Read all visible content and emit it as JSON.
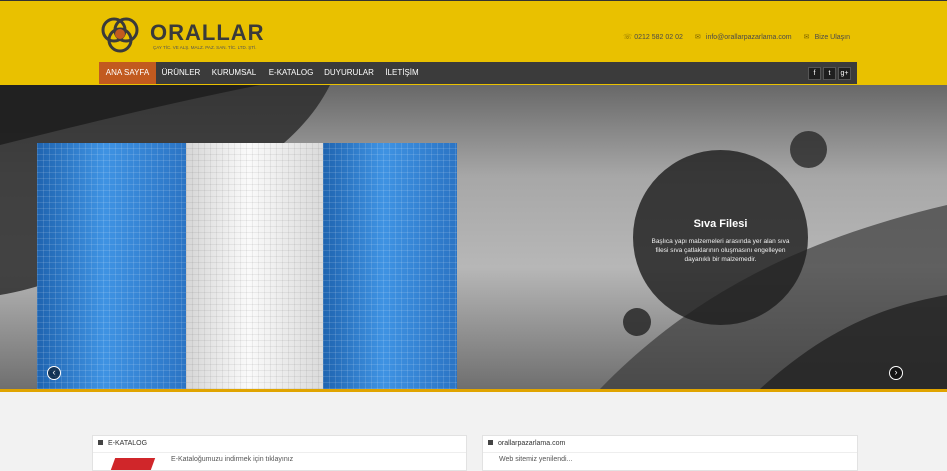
{
  "header": {
    "logo_text": "ORALLAR",
    "logo_subtitle": "ÇAY TİC. VE ALŞ. MALZ. PAZ. SAN. TİC. LTD. ŞTİ.",
    "phone": "0212 582 02 02",
    "email": "info@orallarpazarlama.com",
    "contact_link": "Bize Ulaşın"
  },
  "nav": {
    "items": [
      "ANA SAYFA",
      "ÜRÜNLER",
      "KURUMSAL",
      "E-KATALOG",
      "DUYURULAR",
      "İLETİŞİM"
    ],
    "social": [
      "f",
      "t",
      "g+"
    ]
  },
  "slider": {
    "title": "Sıva Filesi",
    "description": "Başlıca yapı malzemeleri arasında yer alan sıva filesi sıva çatlaklarının oluşmasını engelleyen dayanıklı bir malzemedir.",
    "prev": "‹",
    "next": "›"
  },
  "panels": {
    "left_title": "E-KATALOG",
    "left_text": "E-Kataloğumuzu indirmek için tıklayınız",
    "right_title": "orallarpazarlama.com",
    "right_text": "Web sitemiz yenilendi..."
  },
  "colors": {
    "header": "#e9c100",
    "nav": "#3b3b3b",
    "active": "#c25a1f",
    "accent_bar": "#e0a400"
  }
}
